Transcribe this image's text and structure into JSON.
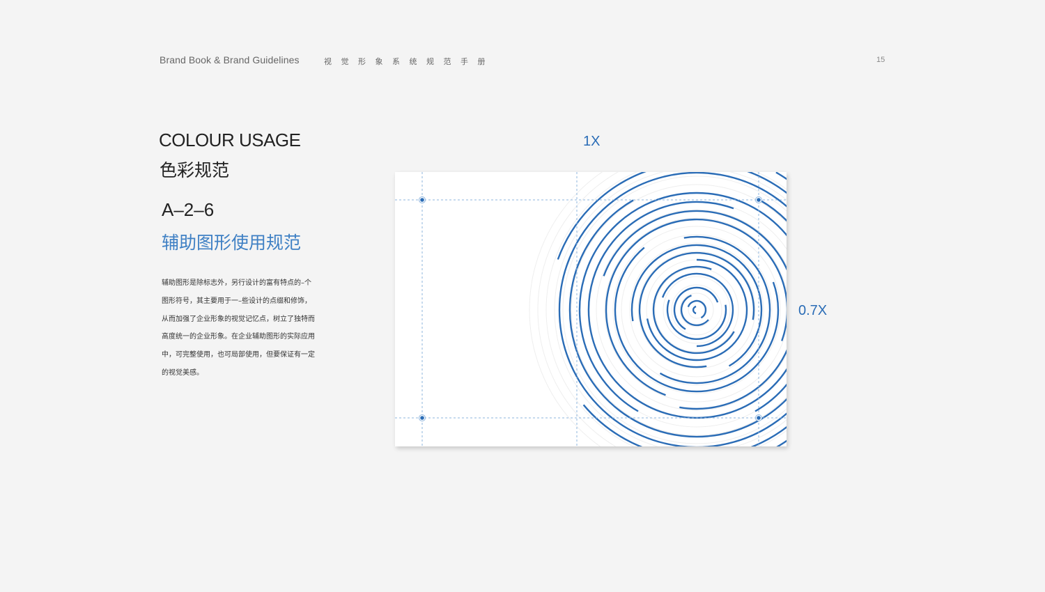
{
  "header": {
    "brand_title": "Brand Book & Brand Guidelines",
    "cn_title": "视觉形象系统规范手册",
    "page_number": "15"
  },
  "section": {
    "title_en": "COLOUR USAGE",
    "title_cn": "色彩规范",
    "code": "A–2–6",
    "subtitle": "辅助图形使用规范",
    "description_lines": [
      "辅助图形是除标志外，另行设计的富有特点的–个",
      "图形符号，其主要用于一–些设计的点缀和修饰，",
      "从而加强了企业形象的视觉记忆点，树立了独特而",
      "高度统一的企业形象。在企业辅助图形的实际应用",
      "中，可完整使用，也可局部使用，但要保证有一定",
      "的视觉美感。"
    ]
  },
  "diagram": {
    "label_width": "1X",
    "label_height": "0.7X",
    "colors": {
      "accent": "#2a6cb6",
      "guide": "#8db4dd",
      "faint_ring": "#eeeeee",
      "background": "#f4f4f4"
    }
  }
}
